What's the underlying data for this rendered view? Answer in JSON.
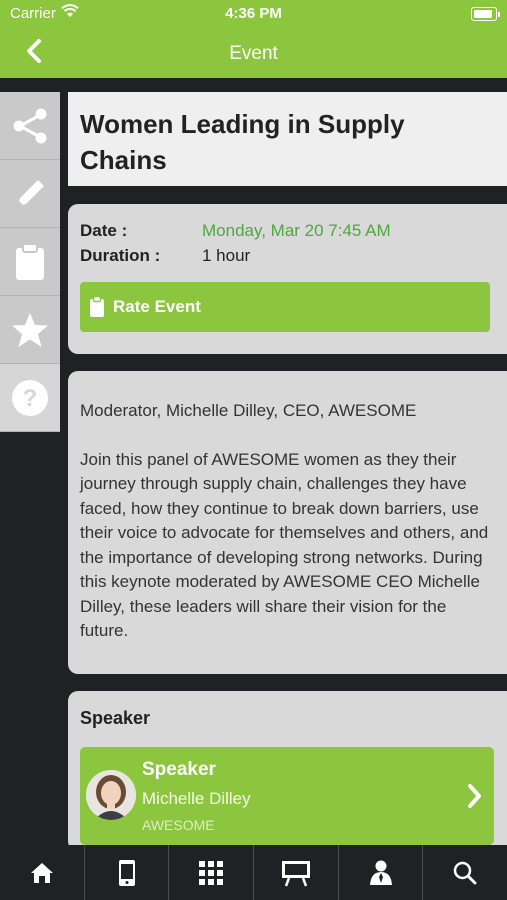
{
  "status": {
    "carrier": "Carrier",
    "time": "4:36 PM"
  },
  "nav": {
    "title": "Event"
  },
  "sidebar": {
    "items": [
      "share-icon",
      "pencil-icon",
      "clipboard-icon",
      "star-icon",
      "help-icon"
    ]
  },
  "event": {
    "title": "Women Leading in Supply Chains",
    "date_label": "Date :",
    "date_value": "Monday, Mar 20 7:45 AM",
    "duration_label": "Duration :",
    "duration_value": "1 hour",
    "rate_label": "Rate Event"
  },
  "description": {
    "moderator": "Moderator, Michelle Dilley, CEO, AWESOME",
    "body": "Join this panel of AWESOME women as they their journey through supply chain, challenges they have faced, how they continue to break down barriers, use their voice to advocate for themselves and others, and the importance of developing strong networks. During this keynote moderated by AWESOME CEO Michelle Dilley, these leaders will share their vision for the future."
  },
  "speaker": {
    "section_title": "Speaker",
    "role": "Speaker",
    "name": "Michelle Dilley",
    "org": "AWESOME"
  },
  "tabs": [
    "home-icon",
    "phone-icon",
    "grid-icon",
    "presentation-icon",
    "person-icon",
    "search-icon"
  ],
  "colors": {
    "accent": "#8cc63f",
    "date_green": "#4da83d",
    "dark": "#1f2124"
  }
}
